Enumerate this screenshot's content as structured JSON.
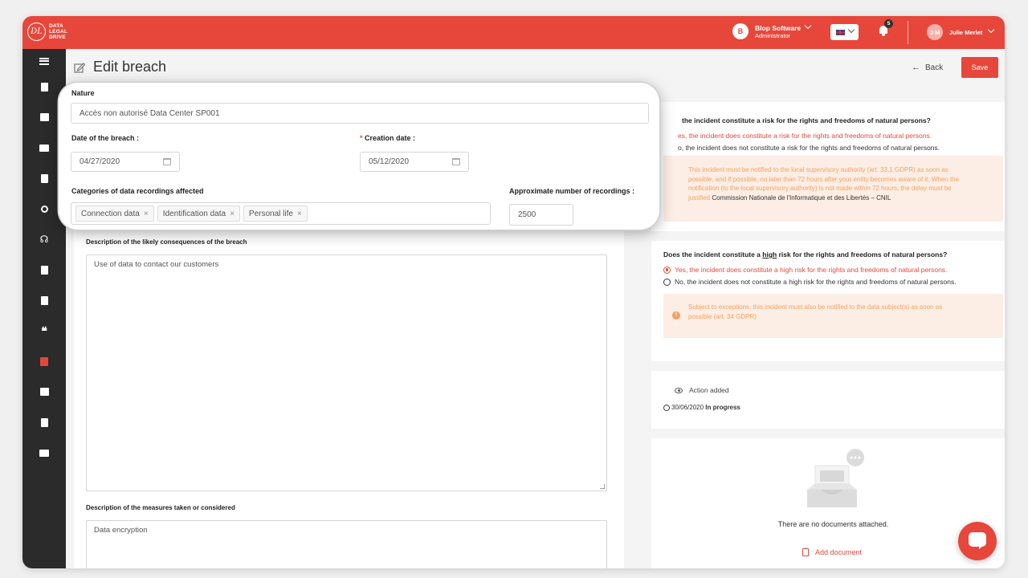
{
  "header": {
    "logo_mark": "DL",
    "logo_line1": "DATA",
    "logo_line2": "LEGAL",
    "logo_line3": "DRIVE",
    "company_initial": "B",
    "company_name": "Blop Software",
    "company_role": "Administrator",
    "notifications_count": "5",
    "user_initials": "J M",
    "user_name": "Julie Merlet"
  },
  "page": {
    "title": "Edit breach",
    "back_label": "Back",
    "save_label": "Save"
  },
  "form": {
    "nature_label": "Nature",
    "nature_value": "Accès non autorisé Data Center SP001",
    "breach_date_label": "Date of the breach",
    "breach_date_value": "04/27/2020",
    "creation_date_label": "Creation date",
    "creation_date_value": "05/12/2020",
    "categories_label": "Categories of data recordings affected",
    "categories": [
      "Connection data",
      "Identification data",
      "Personal life"
    ],
    "recordings_label": "Approximate number of recordings",
    "recordings_value": "2500",
    "consequences_label": "Description of the likely consequences of the breach",
    "consequences_value": "Use of data to contact our customers",
    "measures_label": "Description of the measures taken or considered",
    "measures_value": "Data encryption"
  },
  "risk": {
    "question": "the incident constitute a risk for the rights and freedoms of natural persons?",
    "yes_option": "es, the incident does constitute a risk for the rights and freedoms of natural persons.",
    "no_option": "o, the incident does not constitute a risk for the rights and freedoms of natural persons.",
    "alert_lines": [
      "This incident must be notified to the local supervisory authority (art. 33.1 GDPR) as soon as",
      "possible, and if possible, no later than 72 hours after your entity becomes aware of it. When the",
      "notification (to the local supervisory authority) is not made within 72 hours, the delay must be"
    ],
    "alert_last_orange": "justified",
    "alert_last_dark": "Commission Nationale de l'Informatique et des Libertés – CNIL"
  },
  "high_risk": {
    "question_prefix": "Does the incident constitute a ",
    "question_underlined": "high",
    "question_suffix": " risk for the rights and freedoms of natural persons?",
    "yes_option": "Yes, the incident does constitute a high risk for the rights and freedoms of natural persons.",
    "no_option": "No, the incident does not constitute a high risk for the rights and freedoms of natural persons.",
    "alert_line1": "Subject to exceptions, this incident must also be notified to the data subject(s) as soon as",
    "alert_line2": "possible (art. 34 GDPR)"
  },
  "action": {
    "label": "Action added",
    "date": "30/06/2020",
    "status": "In progress"
  },
  "documents": {
    "empty_text": "There are no documents attached.",
    "add_label": "Add document"
  },
  "colors": {
    "brand": "#e6473a",
    "sidebar": "#2b2b2b",
    "alert_bg": "#fdeee5",
    "alert_text": "#f3a05e"
  }
}
